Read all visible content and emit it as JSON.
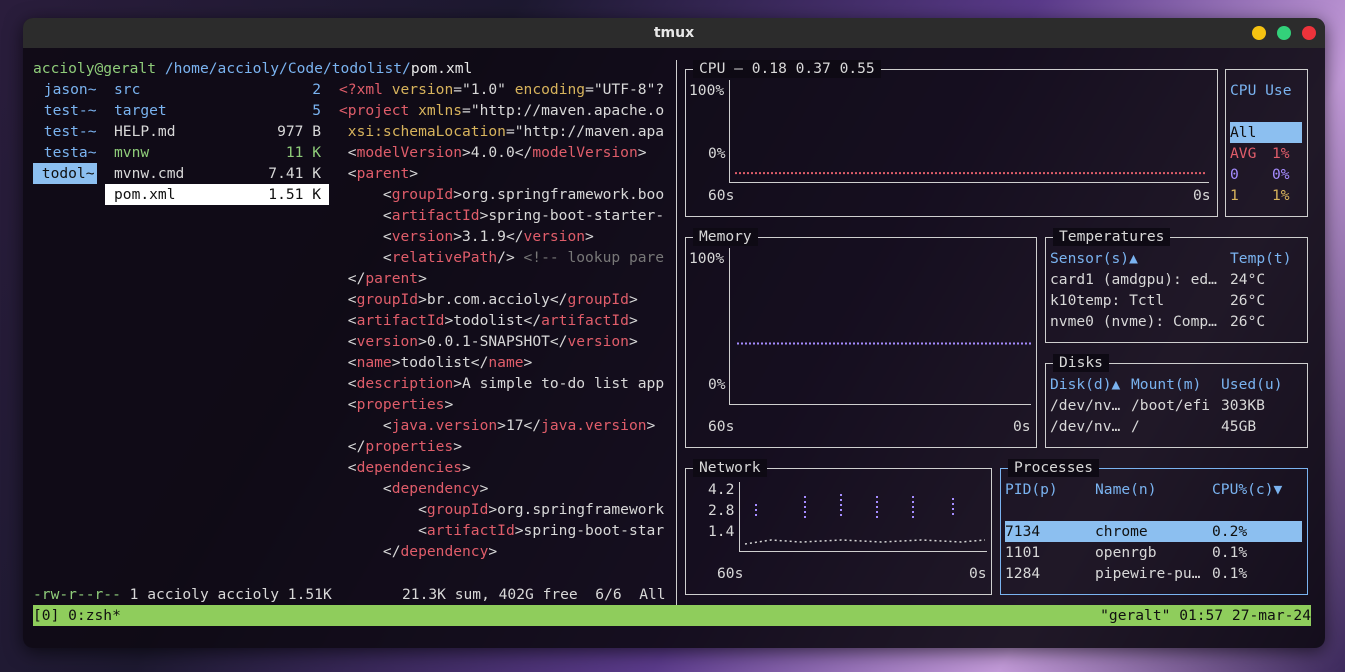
{
  "window": {
    "title": "tmux"
  },
  "ranger": {
    "path_user": "accioly@geralt",
    "path_dir": "/home/accioly/Code/todolist/",
    "path_file": "pom.xml",
    "parent_dirs": [
      "jason~",
      "test-~",
      "test-~",
      "testa~",
      "todol~"
    ],
    "files": [
      {
        "name": "src",
        "size": "2"
      },
      {
        "name": "target",
        "size": "5"
      },
      {
        "name": "HELP.md",
        "size": "977 B"
      },
      {
        "name": "mvnw",
        "size": "11 K"
      },
      {
        "name": "mvnw.cmd",
        "size": "7.41 K"
      },
      {
        "name": "pom.xml",
        "size": "1.51 K"
      }
    ],
    "status_perms": "-rw-r--r--",
    "status_info": " 1 accioly accioly 1.51K",
    "status_sum": "21.3K sum, 402G free  6/6  All"
  },
  "preview": [
    [
      [
        "<?",
        "tag"
      ],
      [
        "xml ",
        "tag"
      ],
      [
        "version",
        "attr"
      ],
      [
        "=\"1.0\" ",
        "str"
      ],
      [
        "encoding",
        "attr"
      ],
      [
        "=\"UTF-8\"?",
        "str"
      ]
    ],
    [
      [
        "<",
        "tag"
      ],
      [
        "project ",
        "tag"
      ],
      [
        "xmlns",
        "attr"
      ],
      [
        "=\"http://maven.apache.o",
        "str"
      ]
    ],
    [
      [
        " xsi:schemaLocation",
        "attr"
      ],
      [
        "=\"http://maven.apa",
        "str"
      ]
    ],
    [
      [
        " <",
        "str"
      ],
      [
        "modelVersion",
        "tag"
      ],
      [
        ">4.0.0</",
        "str"
      ],
      [
        "modelVersion",
        "tag"
      ],
      [
        ">",
        "str"
      ]
    ],
    [
      [
        " <",
        "str"
      ],
      [
        "parent",
        "tag"
      ],
      [
        ">",
        "str"
      ]
    ],
    [
      [
        "     <",
        "str"
      ],
      [
        "groupId",
        "tag"
      ],
      [
        ">org.springframework.boo",
        "str"
      ]
    ],
    [
      [
        "     <",
        "str"
      ],
      [
        "artifactId",
        "tag"
      ],
      [
        ">spring-boot-starter-",
        "str"
      ]
    ],
    [
      [
        "     <",
        "str"
      ],
      [
        "version",
        "tag"
      ],
      [
        ">3.1.9</",
        "str"
      ],
      [
        "version",
        "tag"
      ],
      [
        ">",
        "str"
      ]
    ],
    [
      [
        "     <",
        "str"
      ],
      [
        "relativePath",
        "tag"
      ],
      [
        "/> ",
        "str"
      ],
      [
        "<!-- lookup pare",
        "gray"
      ]
    ],
    [
      [
        " </",
        "str"
      ],
      [
        "parent",
        "tag"
      ],
      [
        ">",
        "str"
      ]
    ],
    [
      [
        " <",
        "str"
      ],
      [
        "groupId",
        "tag"
      ],
      [
        ">br.com.accioly</",
        "str"
      ],
      [
        "groupId",
        "tag"
      ],
      [
        ">",
        "str"
      ]
    ],
    [
      [
        " <",
        "str"
      ],
      [
        "artifactId",
        "tag"
      ],
      [
        ">todolist</",
        "str"
      ],
      [
        "artifactId",
        "tag"
      ],
      [
        ">",
        "str"
      ]
    ],
    [
      [
        " <",
        "str"
      ],
      [
        "version",
        "tag"
      ],
      [
        ">0.0.1-SNAPSHOT</",
        "str"
      ],
      [
        "version",
        "tag"
      ],
      [
        ">",
        "str"
      ]
    ],
    [
      [
        " <",
        "str"
      ],
      [
        "name",
        "tag"
      ],
      [
        ">todolist</",
        "str"
      ],
      [
        "name",
        "tag"
      ],
      [
        ">",
        "str"
      ]
    ],
    [
      [
        " <",
        "str"
      ],
      [
        "description",
        "tag"
      ],
      [
        ">A simple to-do list app",
        "str"
      ]
    ],
    [
      [
        " <",
        "str"
      ],
      [
        "properties",
        "tag"
      ],
      [
        ">",
        "str"
      ]
    ],
    [
      [
        "     <",
        "str"
      ],
      [
        "java.version",
        "tag"
      ],
      [
        ">17</",
        "str"
      ],
      [
        "java.version",
        "tag"
      ],
      [
        ">",
        "str"
      ]
    ],
    [
      [
        " </",
        "str"
      ],
      [
        "properties",
        "tag"
      ],
      [
        ">",
        "str"
      ]
    ],
    [
      [
        " <",
        "str"
      ],
      [
        "dependencies",
        "tag"
      ],
      [
        ">",
        "str"
      ]
    ],
    [
      [
        "     <",
        "str"
      ],
      [
        "dependency",
        "tag"
      ],
      [
        ">",
        "str"
      ]
    ],
    [
      [
        "         <",
        "str"
      ],
      [
        "groupId",
        "tag"
      ],
      [
        ">org.springframework",
        "str"
      ]
    ],
    [
      [
        "         <",
        "str"
      ],
      [
        "artifactId",
        "tag"
      ],
      [
        ">spring-boot-star",
        "str"
      ]
    ],
    [
      [
        "     </",
        "str"
      ],
      [
        "dependency",
        "tag"
      ],
      [
        ">",
        "str"
      ]
    ]
  ],
  "btm": {
    "cpu": {
      "title": "CPU — 0.18 0.37 0.55",
      "y_max": "100%",
      "y_min": "0%",
      "x_left": "60s",
      "x_right": "0s",
      "usage": 0.01
    },
    "cpu_use": {
      "title": "CPU Use",
      "rows": [
        {
          "label": "All",
          "value": ""
        },
        {
          "label": "AVG",
          "value": "1%"
        },
        {
          "label": "0",
          "value": "0%"
        },
        {
          "label": "1",
          "value": "1%"
        }
      ]
    },
    "memory": {
      "title": "Memory",
      "y_max": "100%",
      "y_min": "0%",
      "x_left": "60s",
      "x_right": "0s",
      "usage": 0.36
    },
    "temps": {
      "title": "Temperatures",
      "col1": "Sensor(s)▲",
      "col2": "Temp(t)",
      "rows": [
        {
          "sensor": "card1 (amdgpu): ed…",
          "temp": "24°C"
        },
        {
          "sensor": "k10temp: Tctl",
          "temp": "26°C"
        },
        {
          "sensor": "nvme0 (nvme): Comp…",
          "temp": "26°C"
        }
      ]
    },
    "disks": {
      "title": "Disks",
      "col1": "Disk(d)▲",
      "col2": "Mount(m)",
      "col3": "Used(u)",
      "rows": [
        {
          "disk": "/dev/nv…",
          "mount": "/boot/efi",
          "used": "303KB"
        },
        {
          "disk": "/dev/nv…",
          "mount": "/",
          "used": "45GB"
        }
      ]
    },
    "network": {
      "title": "Network",
      "ticks": [
        "4.2",
        "2.8",
        "1.4"
      ],
      "x_left": "60s",
      "x_right": "0s"
    },
    "processes": {
      "title": "Processes",
      "col1": "PID(p)",
      "col2": "Name(n)",
      "col3": "CPU%(c)▼",
      "rows": [
        {
          "pid": "7134",
          "name": "chrome",
          "cpu": "0.2%"
        },
        {
          "pid": "1101",
          "name": "openrgb",
          "cpu": "0.1%"
        },
        {
          "pid": "1284",
          "name": "pipewire-pu…",
          "cpu": "0.1%"
        }
      ]
    }
  },
  "statusbar": {
    "left": "[0] 0:zsh*",
    "right": "\"geralt\" 01:57 27-mar-24"
  }
}
